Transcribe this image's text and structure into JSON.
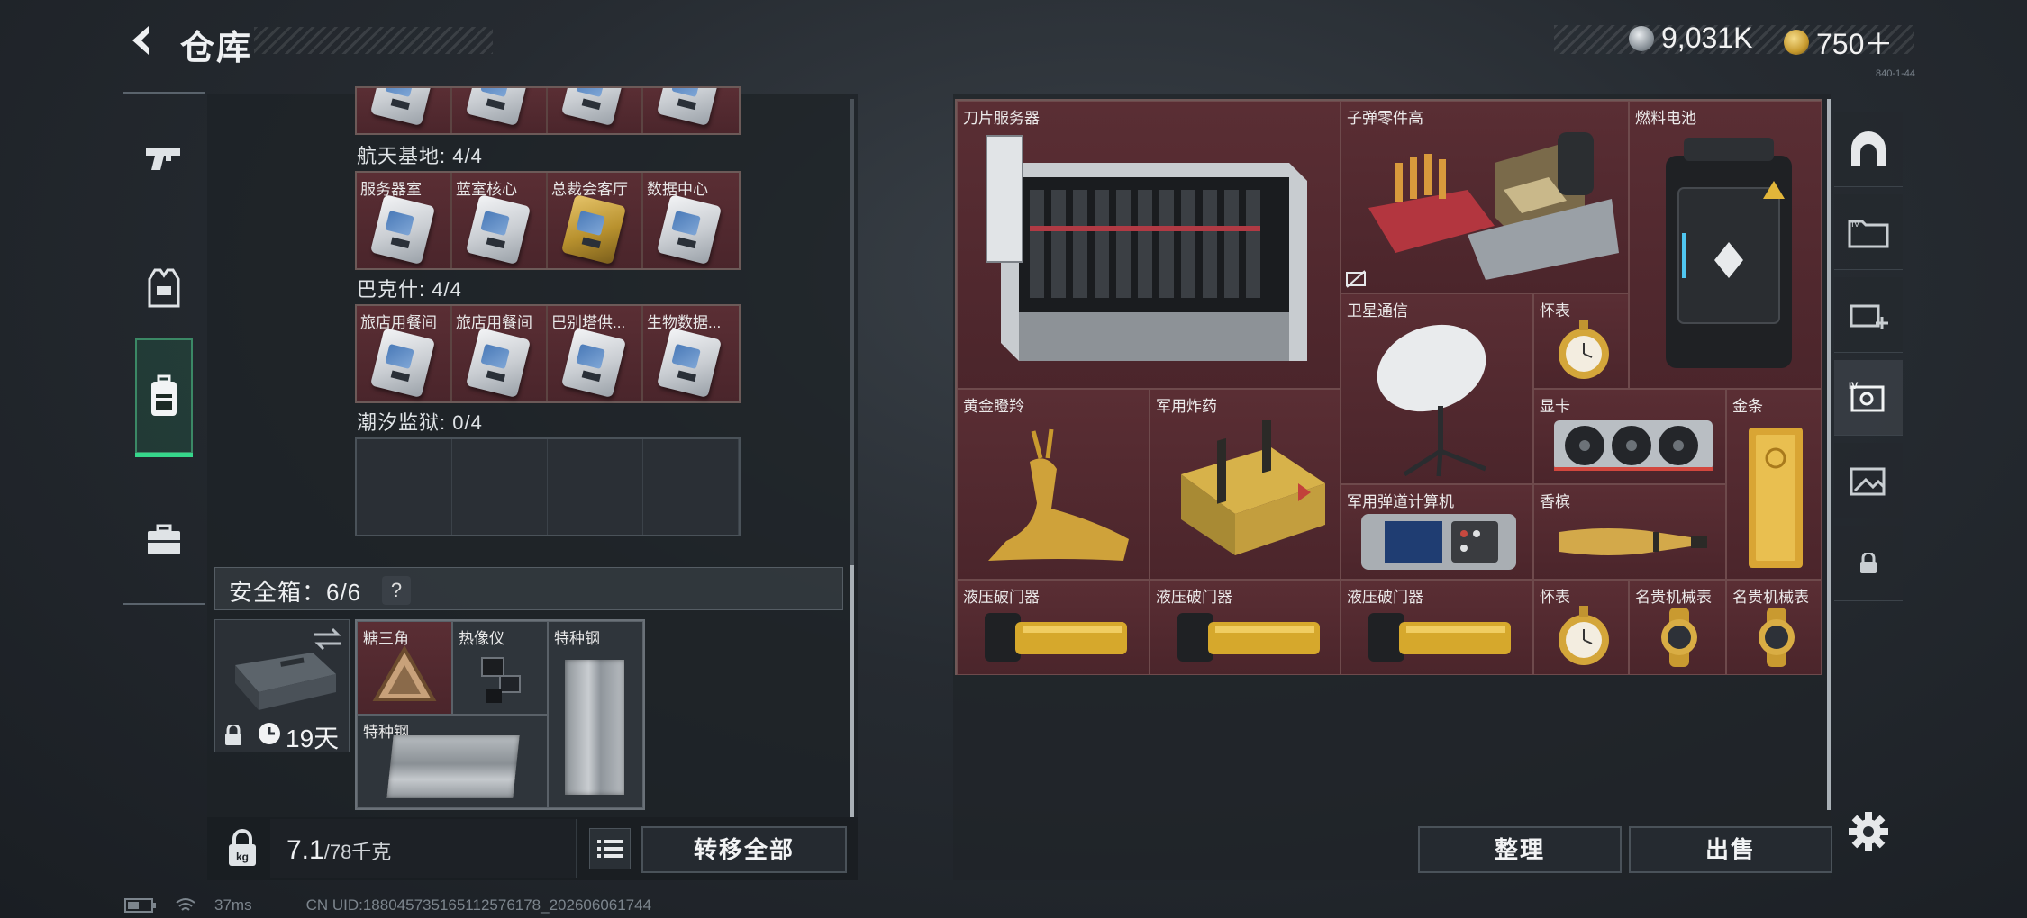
{
  "header": {
    "title": "仓库",
    "currency1": "9,031K",
    "currency2": "750＋",
    "version": "840-1-44"
  },
  "left_nav": {
    "items": [
      {
        "icon": "pistol-icon",
        "active": false
      },
      {
        "icon": "armor-vest-icon",
        "active": false
      },
      {
        "icon": "backpack-icon",
        "active": true
      },
      {
        "icon": "briefcase-icon",
        "active": false
      }
    ]
  },
  "collections": [
    {
      "title": "航天基地: 4/4",
      "items": [
        {
          "label": "服务器室",
          "card": "silver"
        },
        {
          "label": "蓝室核心",
          "card": "silver"
        },
        {
          "label": "总裁会客厅",
          "card": "gold"
        },
        {
          "label": "数据中心",
          "card": "silver"
        }
      ]
    },
    {
      "title": "巴克什: 4/4",
      "items": [
        {
          "label": "旅店用餐间",
          "card": "silver"
        },
        {
          "label": "旅店用餐间",
          "card": "silver"
        },
        {
          "label": "巴别塔供...",
          "card": "silver"
        },
        {
          "label": "生物数据...",
          "card": "silver"
        }
      ]
    },
    {
      "title": "潮汐监狱: 0/4",
      "items": [
        {
          "label": "",
          "card": "none"
        },
        {
          "label": "",
          "card": "none"
        },
        {
          "label": "",
          "card": "none"
        },
        {
          "label": "",
          "card": "none"
        }
      ]
    }
  ],
  "safe_box": {
    "title": "安全箱：6/6",
    "help": "?",
    "duration": "19天",
    "items": [
      {
        "label": "糖三角"
      },
      {
        "label": "热像仪"
      },
      {
        "label": "特种钢"
      },
      {
        "label": "特种钢"
      }
    ]
  },
  "bottom_left": {
    "weight_value": "7.1",
    "weight_max": "/78千克",
    "transfer_all": "转移全部"
  },
  "stash": {
    "items": [
      {
        "label": "刀片服务器"
      },
      {
        "label": "子弹零件高"
      },
      {
        "label": "燃料电池"
      },
      {
        "label": "卫星通信"
      },
      {
        "label": "怀表"
      },
      {
        "label": "黄金瞪羚"
      },
      {
        "label": "军用炸药"
      },
      {
        "label": "显卡"
      },
      {
        "label": "金条"
      },
      {
        "label": "军用弹道计算机"
      },
      {
        "label": "香槟"
      },
      {
        "label": "液压破门器"
      },
      {
        "label": "液压破门器"
      },
      {
        "label": "液压破门器"
      },
      {
        "label": "怀表"
      },
      {
        "label": "名贵机械表"
      },
      {
        "label": "名贵机械表"
      }
    ],
    "sort": "整理",
    "sell": "出售"
  },
  "status_bar": {
    "ping": "37ms",
    "uid": "CN UID:18804573516511257617​8_202606061744"
  },
  "colors": {
    "accent_green": "#36d68b",
    "item_bg": "#5a2e34",
    "panel_bg": "#1e2227"
  }
}
